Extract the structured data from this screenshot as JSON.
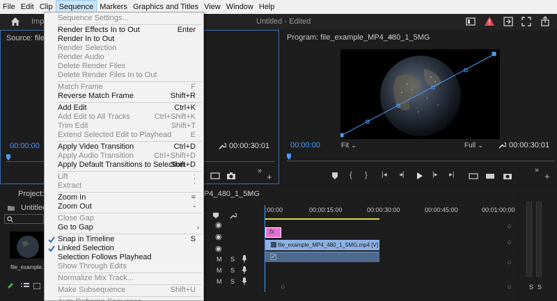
{
  "menubar": [
    "File",
    "Edit",
    "Clip",
    "Sequence",
    "Markers",
    "Graphics and Titles",
    "View",
    "Window",
    "Help"
  ],
  "header": {
    "import_tab": "Imp",
    "doc_title": "Untitled  - Edited"
  },
  "source": {
    "title": "Source: file_exa",
    "timecode": "00:00:00",
    "duration": "00:00:30:01"
  },
  "program": {
    "title": "Program: file_example_MP4_480_1_5MG",
    "title_icon": "≡",
    "timecode": "00:00:00",
    "fit": "Fit",
    "full": "Full",
    "duration": "00:00:30:01"
  },
  "project": {
    "tab": "Project: Un",
    "file": "Untitled.p",
    "thumb_label": "file_example..."
  },
  "timeline": {
    "tab": "P4_480_1_5MG",
    "tab_icon": "≡",
    "ruler": [
      ":00:00",
      "00:00:15:00",
      "00:00:30:00",
      "00:00:45:00",
      "00:01:00:00"
    ],
    "fx_label": "fx",
    "video_clip": "file_example_MP4_480_1_5MG.mp4 [V]",
    "m_label": "M",
    "s_label": "S"
  },
  "meter": {
    "s1": "S",
    "s2": "S"
  },
  "menu": {
    "items": [
      {
        "label": "Sequence Settings...",
        "shortcut": "",
        "disabled": true,
        "checked": false
      },
      {
        "sep": true
      },
      {
        "label": "Render Effects In to Out",
        "shortcut": "Enter",
        "disabled": false,
        "checked": false
      },
      {
        "label": "Render In to Out",
        "shortcut": "",
        "disabled": false,
        "checked": false
      },
      {
        "label": "Render Selection",
        "shortcut": "",
        "disabled": true,
        "checked": false
      },
      {
        "label": "Render Audio",
        "shortcut": "",
        "disabled": true,
        "checked": false
      },
      {
        "label": "Delete Render Files",
        "shortcut": "",
        "disabled": true,
        "checked": false
      },
      {
        "label": "Delete Render Files In to Out",
        "shortcut": "",
        "disabled": true,
        "checked": false
      },
      {
        "sep": true
      },
      {
        "label": "Match Frame",
        "shortcut": "F",
        "disabled": true,
        "checked": false
      },
      {
        "label": "Reverse Match Frame",
        "shortcut": "Shift+R",
        "disabled": false,
        "checked": false
      },
      {
        "sep": true
      },
      {
        "label": "Add Edit",
        "shortcut": "Ctrl+K",
        "disabled": false,
        "checked": false
      },
      {
        "label": "Add Edit to All Tracks",
        "shortcut": "Ctrl+Shift+K",
        "disabled": true,
        "checked": false
      },
      {
        "label": "Trim Edit",
        "shortcut": "Shift+T",
        "disabled": true,
        "checked": false
      },
      {
        "label": "Extend Selected Edit to Playhead",
        "shortcut": "E",
        "disabled": true,
        "checked": false
      },
      {
        "sep": true
      },
      {
        "label": "Apply Video Transition",
        "shortcut": "Ctrl+D",
        "disabled": false,
        "checked": false
      },
      {
        "label": "Apply Audio Transition",
        "shortcut": "Ctrl+Shift+D",
        "disabled": true,
        "checked": false
      },
      {
        "label": "Apply Default Transitions to Selection",
        "shortcut": "Shift+D",
        "disabled": false,
        "checked": false
      },
      {
        "sep": true
      },
      {
        "label": "Lift",
        "shortcut": ";",
        "disabled": true,
        "checked": false
      },
      {
        "label": "Extract",
        "shortcut": "'",
        "disabled": true,
        "checked": false
      },
      {
        "sep": true
      },
      {
        "label": "Zoom In",
        "shortcut": "=",
        "disabled": false,
        "checked": false
      },
      {
        "label": "Zoom Out",
        "shortcut": "-",
        "disabled": false,
        "checked": false
      },
      {
        "sep": true
      },
      {
        "label": "Close Gap",
        "shortcut": "",
        "disabled": true,
        "checked": false
      },
      {
        "label": "Go to Gap",
        "shortcut": "",
        "disabled": false,
        "checked": false,
        "submenu": true
      },
      {
        "sep": true
      },
      {
        "label": "Snap in Timeline",
        "shortcut": "S",
        "disabled": false,
        "checked": true
      },
      {
        "label": "Linked Selection",
        "shortcut": "",
        "disabled": false,
        "checked": true
      },
      {
        "label": "Selection Follows Playhead",
        "shortcut": "",
        "disabled": false,
        "checked": false
      },
      {
        "label": "Show Through Edits",
        "shortcut": "",
        "disabled": true,
        "checked": false
      },
      {
        "sep": true
      },
      {
        "label": "Normalize Mix Track...",
        "shortcut": "",
        "disabled": true,
        "checked": false
      },
      {
        "sep": true
      },
      {
        "label": "Make Subsequence",
        "shortcut": "Shift+U",
        "disabled": true,
        "checked": false
      },
      {
        "sep": true
      },
      {
        "label": "Auto Reframe Sequence...",
        "shortcut": "",
        "disabled": true,
        "checked": false
      }
    ]
  },
  "colors": {
    "accent": "#4b9bff",
    "fx_badge": "#e36fd4",
    "clip": "#8db1e3",
    "menu_bg": "#f2f2f2",
    "active_menu": "#cce4f7"
  }
}
